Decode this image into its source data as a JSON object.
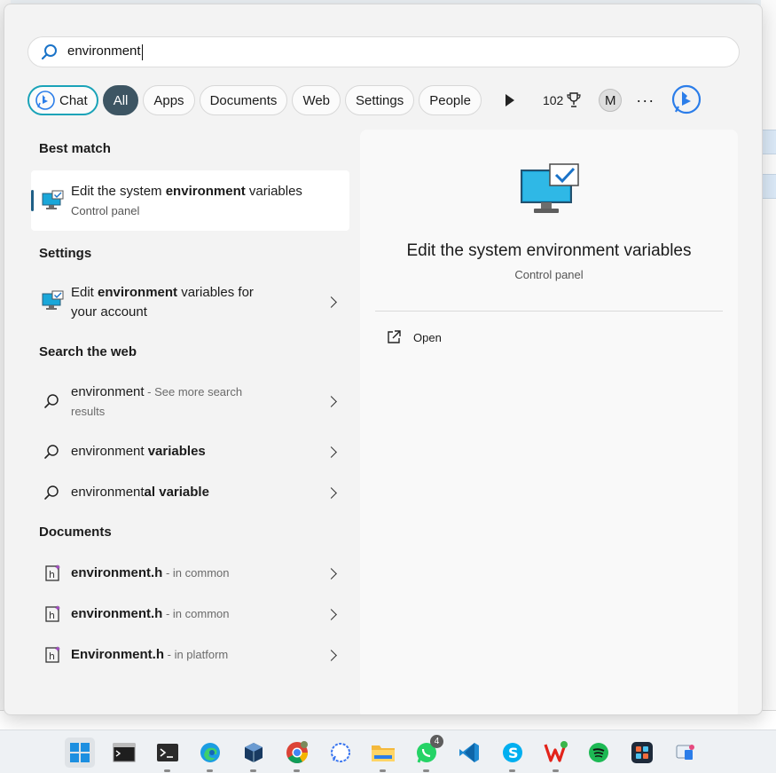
{
  "search": {
    "value": "environment"
  },
  "filters": {
    "chat": "Chat",
    "all": "All",
    "apps": "Apps",
    "documents": "Documents",
    "web": "Web",
    "settings": "Settings",
    "people": "People",
    "points": "102",
    "avatar_initial": "M",
    "more": "···"
  },
  "best_match": {
    "title": "Best match",
    "item": {
      "pre": "Edit the system ",
      "bold": "environment",
      "post": " variables",
      "sub": "Control panel"
    }
  },
  "settings_section": {
    "title": "Settings",
    "item": {
      "pre": "Edit ",
      "bold": "environment",
      "post": " variables for",
      "line2": "your account"
    }
  },
  "web_section": {
    "title": "Search the web",
    "items": [
      {
        "term": "environment",
        "suffix": " - See more search",
        "line2": "results"
      },
      {
        "pre": "environment",
        "bold": " variables"
      },
      {
        "pre": "environment",
        "bold": "al variable"
      }
    ]
  },
  "documents_section": {
    "title": "Documents",
    "items": [
      {
        "name": "environment.h",
        "location": " - in common"
      },
      {
        "name": "environment.h",
        "location": " - in common"
      },
      {
        "name": "Environment.h",
        "location": " - in platform"
      }
    ]
  },
  "preview": {
    "title": "Edit the system environment variables",
    "subtitle": "Control panel",
    "action": "Open"
  },
  "taskbar": {
    "icons": [
      "windows-start-icon",
      "cmd-icon",
      "terminal-icon",
      "edge-icon",
      "virtualbox-icon",
      "chrome-icon",
      "signal-icon",
      "file-explorer-icon",
      "whatsapp-icon",
      "vscode-icon",
      "skype-icon",
      "wps-office-icon",
      "spotify-icon",
      "app-grid-icon",
      "snipping-tool-icon"
    ],
    "whatsapp_badge": "4"
  },
  "colors": {
    "accent": "#1f5f86",
    "all_pill": "#3d5563",
    "chat_border": "#1aa3b8"
  }
}
